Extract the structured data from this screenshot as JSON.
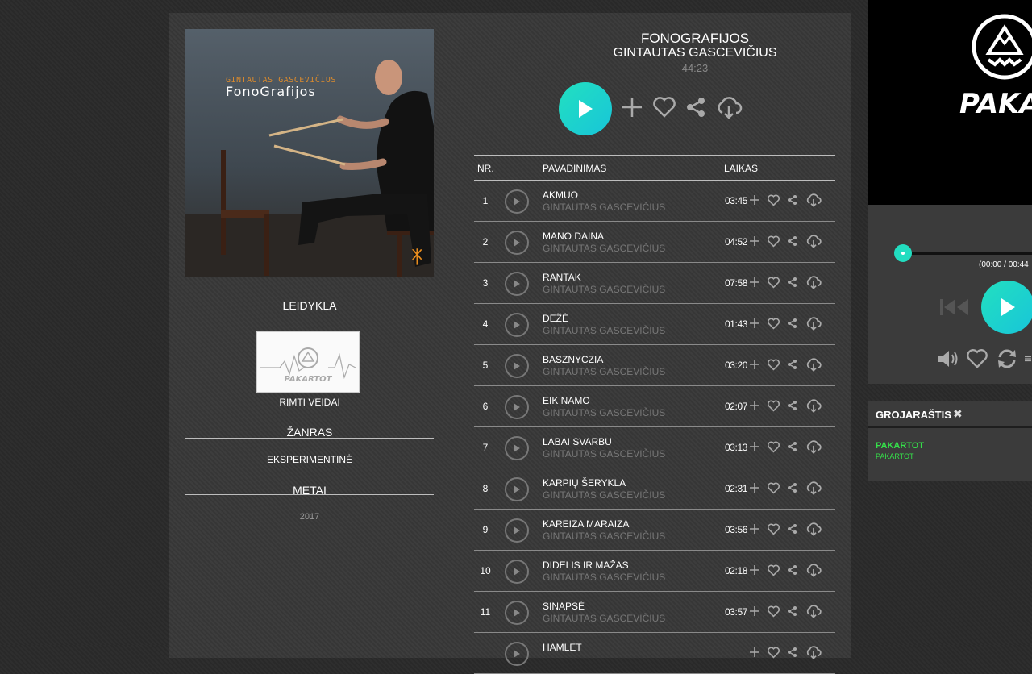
{
  "album": {
    "title": "FONOGRAFIJOS",
    "artist": "GINTAUTAS GASCEVIČIUS",
    "duration": "44:23",
    "cover_artist": "GINTAUTAS GASCEVIČIUS",
    "cover_title": "FonoGrafijos",
    "cover_glyph": "ᛡ"
  },
  "sidebar": {
    "label_heading": "LEIDYKLA",
    "label_name": "RIMTI VEIDAI",
    "label_logo_text": "PAKARTOT",
    "genre_heading": "ŽANRAS",
    "genre": "EKSPERIMENTINĖ",
    "year_heading": "METAI",
    "year": "2017"
  },
  "table": {
    "col_nr": "NR.",
    "col_name": "PAVADINIMAS",
    "col_time": "LAIKAS",
    "tracks": [
      {
        "nr": "1",
        "title": "AKMUO",
        "artist": "GINTAUTAS GASCEVIČIUS",
        "dur": "03:45"
      },
      {
        "nr": "2",
        "title": "MANO DAINA",
        "artist": "GINTAUTAS GASCEVIČIUS",
        "dur": "04:52"
      },
      {
        "nr": "3",
        "title": "RANTAK",
        "artist": "GINTAUTAS GASCEVIČIUS",
        "dur": "07:58"
      },
      {
        "nr": "4",
        "title": "DEŽĖ",
        "artist": "GINTAUTAS GASCEVIČIUS",
        "dur": "01:43"
      },
      {
        "nr": "5",
        "title": "BASZNYCZIA",
        "artist": "GINTAUTAS GASCEVIČIUS",
        "dur": "03:20"
      },
      {
        "nr": "6",
        "title": "EIK NAMO",
        "artist": "GINTAUTAS GASCEVIČIUS",
        "dur": "02:07"
      },
      {
        "nr": "7",
        "title": "LABAI SVARBU",
        "artist": "GINTAUTAS GASCEVIČIUS",
        "dur": "03:13"
      },
      {
        "nr": "8",
        "title": "KARPIŲ ŠERYKLA",
        "artist": "GINTAUTAS GASCEVIČIUS",
        "dur": "02:31"
      },
      {
        "nr": "9",
        "title": "KAREIZA MARAIZA",
        "artist": "GINTAUTAS GASCEVIČIUS",
        "dur": "03:56"
      },
      {
        "nr": "10",
        "title": "DIDELIS IR MAŽAS",
        "artist": "GINTAUTAS GASCEVIČIUS",
        "dur": "02:18"
      },
      {
        "nr": "11",
        "title": "SINAPSĖ",
        "artist": "GINTAUTAS GASCEVIČIUS",
        "dur": "03:57"
      },
      {
        "nr": "",
        "title": "HAMLET",
        "artist": "",
        "dur": ""
      }
    ]
  },
  "brand": {
    "name": "PAKARTOT"
  },
  "player": {
    "time_readout": "(00:00 / 00:44"
  },
  "playlist": {
    "title": "GROJARAŠTIS",
    "close_icon": "✖",
    "item_title": "PAKARTOT",
    "item_sub": "PAKARTOT"
  },
  "colors": {
    "accent": "#22ddc0",
    "playlist_green": "#35e04a",
    "cover_orange": "#d98a2e"
  }
}
